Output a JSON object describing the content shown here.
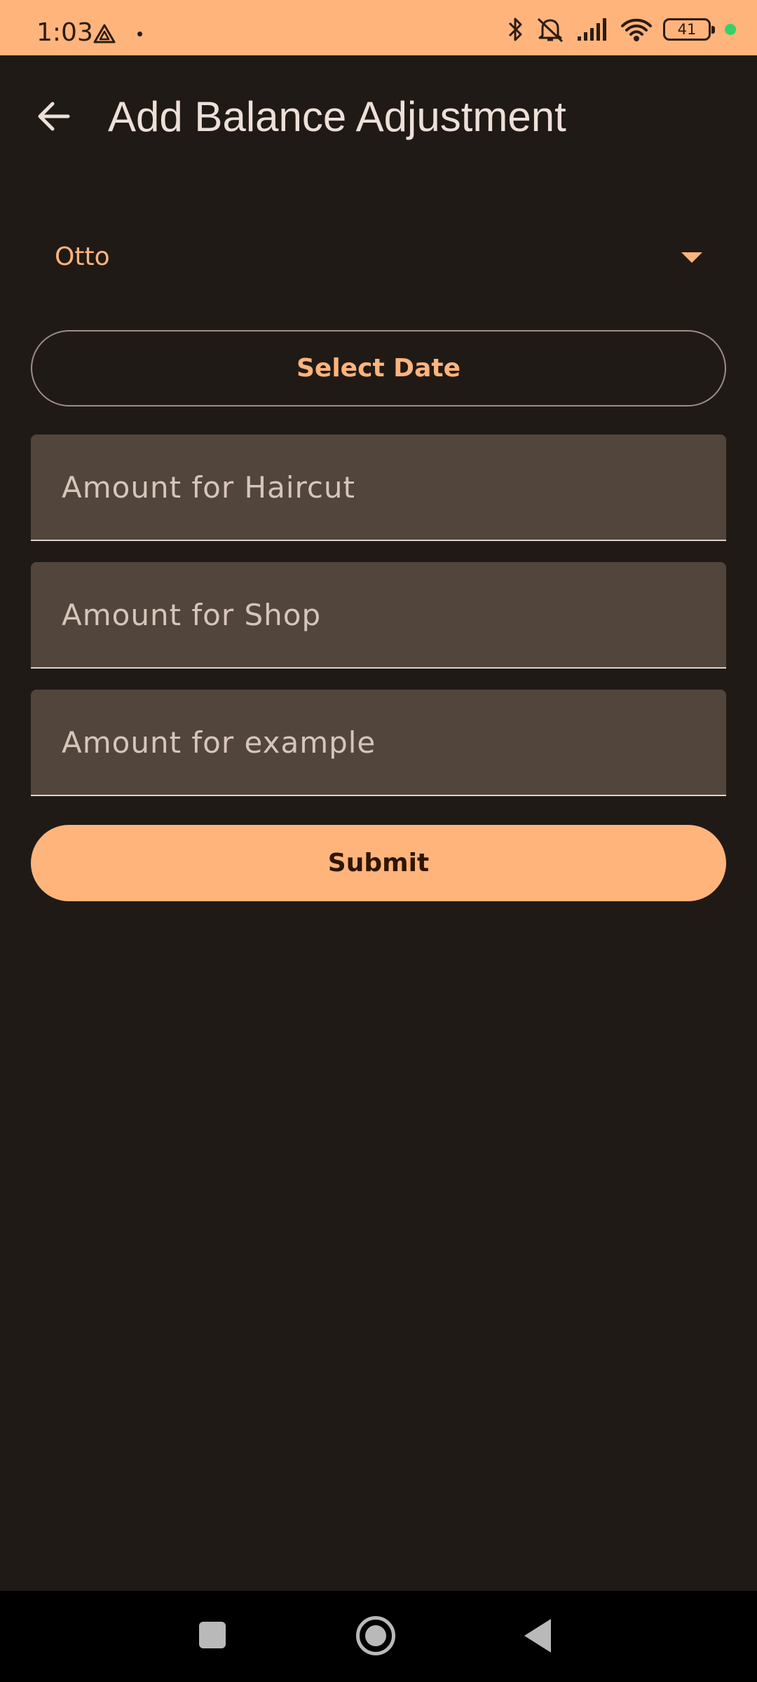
{
  "status_bar": {
    "time": "1:03",
    "battery_level": "41",
    "left_icon": "drive-triangle-icon",
    "right_icons": [
      "bluetooth-icon",
      "mute-icon",
      "signal-icon",
      "wifi-icon",
      "battery-icon"
    ]
  },
  "app_bar": {
    "back_icon": "arrow-back-icon",
    "title": "Add Balance Adjustment"
  },
  "form": {
    "person_select": {
      "value": "Otto",
      "icon": "dropdown-arrow-icon"
    },
    "select_date_label": "Select Date",
    "fields": {
      "haircut_placeholder": "Amount for Haircut",
      "shop_placeholder": "Amount for Shop",
      "example_placeholder": "Amount for example"
    },
    "submit_label": "Submit"
  },
  "colors": {
    "accent": "#ffb47c",
    "background": "#201a17",
    "field_fill": "#52453c",
    "on_surface": "#ede0d8"
  },
  "nav_bar": {
    "icons": [
      "recents-square-icon",
      "home-circle-icon",
      "back-triangle-icon"
    ]
  }
}
